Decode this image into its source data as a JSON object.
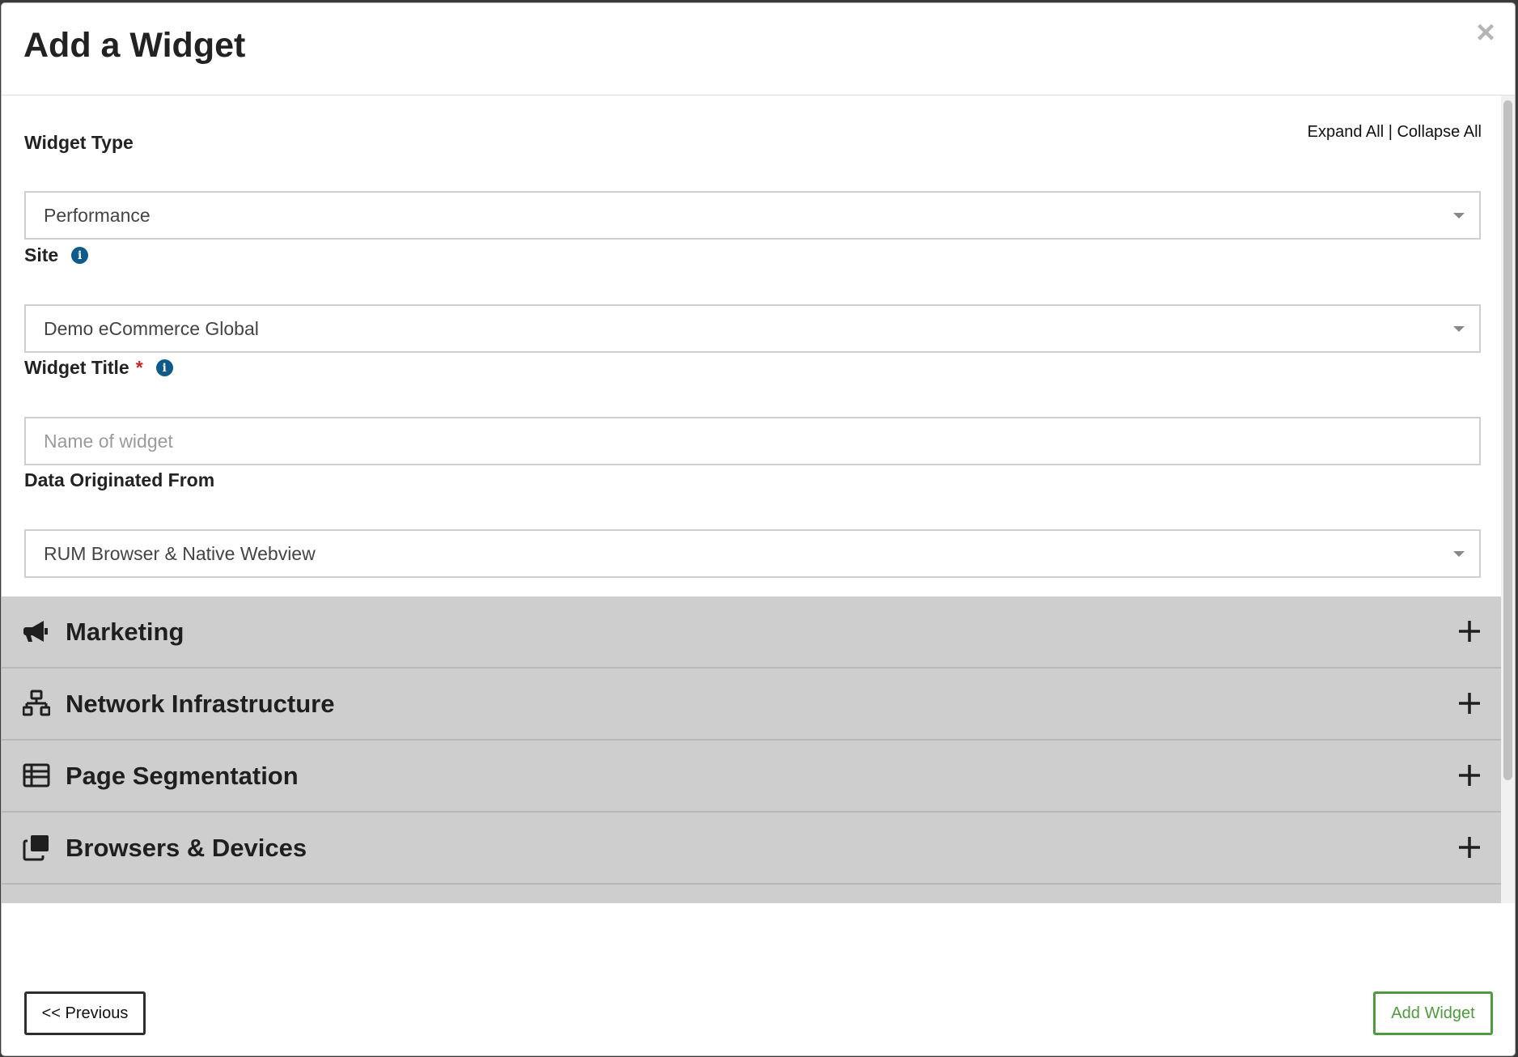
{
  "modal": {
    "title": "Add a Widget",
    "close_label": "×"
  },
  "links": {
    "expand_all": "Expand All",
    "separator": "|",
    "collapse_all": "Collapse All"
  },
  "fields": {
    "widget_type": {
      "label": "Widget Type",
      "value": "Performance"
    },
    "site": {
      "label": "Site",
      "value": "Demo eCommerce Global"
    },
    "widget_title": {
      "label": "Widget Title",
      "required_mark": "*",
      "placeholder": "Name of widget",
      "value": ""
    },
    "data_origin": {
      "label": "Data Originated From",
      "value": "RUM Browser & Native Webview"
    }
  },
  "accordion": [
    {
      "label": "Marketing",
      "icon": "bullhorn-icon"
    },
    {
      "label": "Network Infrastructure",
      "icon": "network-icon"
    },
    {
      "label": "Page Segmentation",
      "icon": "list-icon"
    },
    {
      "label": "Browsers & Devices",
      "icon": "copy-windows-icon"
    }
  ],
  "footer": {
    "previous_label": "<< Previous",
    "add_label": "Add Widget"
  },
  "colors": {
    "info": "#0e5a8a",
    "required": "#c62828",
    "add_button": "#4e9a3e",
    "accordion_bg": "#cecece"
  }
}
